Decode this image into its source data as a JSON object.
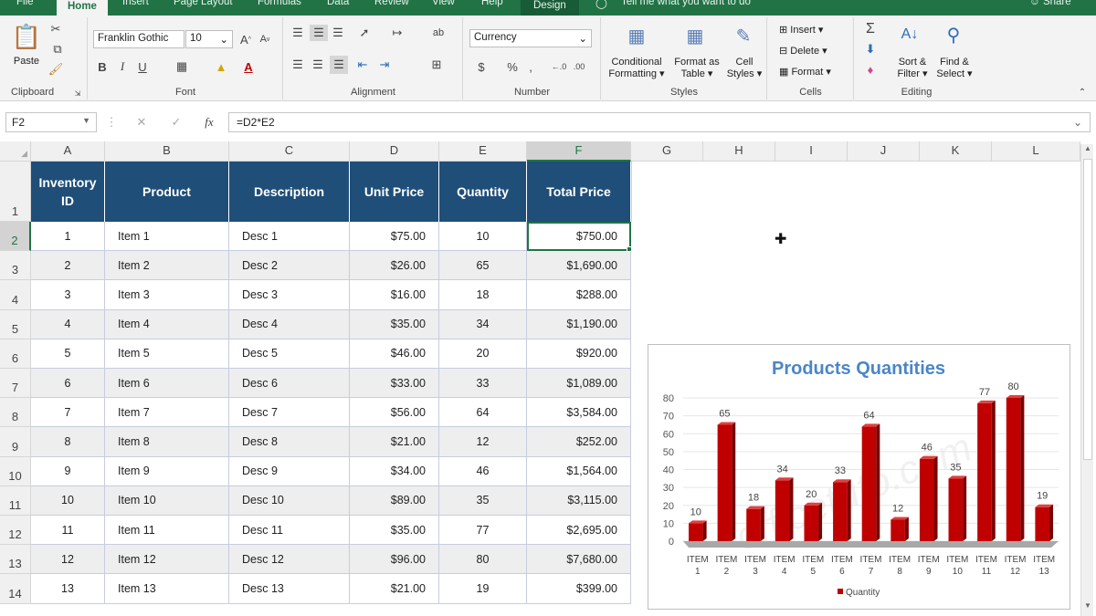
{
  "tabs": [
    "File",
    "Home",
    "Insert",
    "Page Layout",
    "Formulas",
    "Data",
    "Review",
    "View",
    "Help",
    "Design"
  ],
  "tell_me": "Tell me what you want to do",
  "share": "Share",
  "clipboard": {
    "paste": "Paste",
    "label": "Clipboard"
  },
  "font": {
    "name": "Franklin Gothic",
    "size": "10",
    "label": "Font"
  },
  "alignment": {
    "label": "Alignment"
  },
  "number": {
    "format": "Currency",
    "dollar": "$",
    "percent": "%",
    "comma": ",",
    "label": "Number"
  },
  "styles": {
    "conditional": "Conditional",
    "formatting": "Formatting",
    "format_as": "Format as",
    "table": "Table",
    "cell": "Cell",
    "cell_styles": "Styles",
    "label": "Styles"
  },
  "cells": {
    "insert": "Insert",
    "delete": "Delete",
    "format": "Format",
    "label": "Cells"
  },
  "editing": {
    "sort": "Sort &",
    "filter": "Filter",
    "find": "Find &",
    "select": "Select",
    "label": "Editing"
  },
  "formula_bar": {
    "cell_ref": "F2",
    "formula": "=D2*E2",
    "fx": "fx"
  },
  "columns": [
    "A",
    "B",
    "C",
    "D",
    "E",
    "F",
    "G",
    "H",
    "I",
    "J",
    "K",
    "L"
  ],
  "row_numbers": [
    "1",
    "2",
    "3",
    "4",
    "5",
    "6",
    "7",
    "8",
    "9",
    "10",
    "11",
    "12",
    "13",
    "14"
  ],
  "table_headers": [
    "Inventory ID",
    "Product",
    "Description",
    "Unit Price",
    "Quantity",
    "Total Price"
  ],
  "rows": [
    [
      "1",
      "Item 1",
      "Desc 1",
      "$75.00",
      "10",
      "$750.00"
    ],
    [
      "2",
      "Item 2",
      "Desc 2",
      "$26.00",
      "65",
      "$1,690.00"
    ],
    [
      "3",
      "Item 3",
      "Desc 3",
      "$16.00",
      "18",
      "$288.00"
    ],
    [
      "4",
      "Item 4",
      "Desc 4",
      "$35.00",
      "34",
      "$1,190.00"
    ],
    [
      "5",
      "Item 5",
      "Desc 5",
      "$46.00",
      "20",
      "$920.00"
    ],
    [
      "6",
      "Item 6",
      "Desc 6",
      "$33.00",
      "33",
      "$1,089.00"
    ],
    [
      "7",
      "Item 7",
      "Desc 7",
      "$56.00",
      "64",
      "$3,584.00"
    ],
    [
      "8",
      "Item 8",
      "Desc 8",
      "$21.00",
      "12",
      "$252.00"
    ],
    [
      "9",
      "Item 9",
      "Desc 9",
      "$34.00",
      "46",
      "$1,564.00"
    ],
    [
      "10",
      "Item 10",
      "Desc 10",
      "$89.00",
      "35",
      "$3,115.00"
    ],
    [
      "11",
      "Item 11",
      "Desc 11",
      "$35.00",
      "77",
      "$2,695.00"
    ],
    [
      "12",
      "Item 12",
      "Desc 12",
      "$96.00",
      "80",
      "$7,680.00"
    ],
    [
      "13",
      "Item 13",
      "Desc 13",
      "$21.00",
      "19",
      "$399.00"
    ]
  ],
  "colors": {
    "header_bg": "#1f4e79",
    "bar": "#c00000",
    "bar_dark": "#7a0000",
    "title": "#4a86c8",
    "accent": "#217346"
  },
  "chart_data": {
    "type": "bar",
    "title": "Products Quantities",
    "categories": [
      "ITEM 1",
      "ITEM 2",
      "ITEM 3",
      "ITEM 4",
      "ITEM 5",
      "ITEM 6",
      "ITEM 7",
      "ITEM 8",
      "ITEM 9",
      "ITEM 10",
      "ITEM 11",
      "ITEM 12",
      "ITEM 13"
    ],
    "series": [
      {
        "name": "Quantity",
        "values": [
          10,
          65,
          18,
          34,
          20,
          33,
          64,
          12,
          46,
          35,
          77,
          80,
          19
        ]
      }
    ],
    "ylim": [
      0,
      80
    ],
    "yticks": [
      0,
      10,
      20,
      30,
      40,
      50,
      60,
      70,
      80
    ],
    "legend": "bottom",
    "watermark": "officetuto.com"
  }
}
